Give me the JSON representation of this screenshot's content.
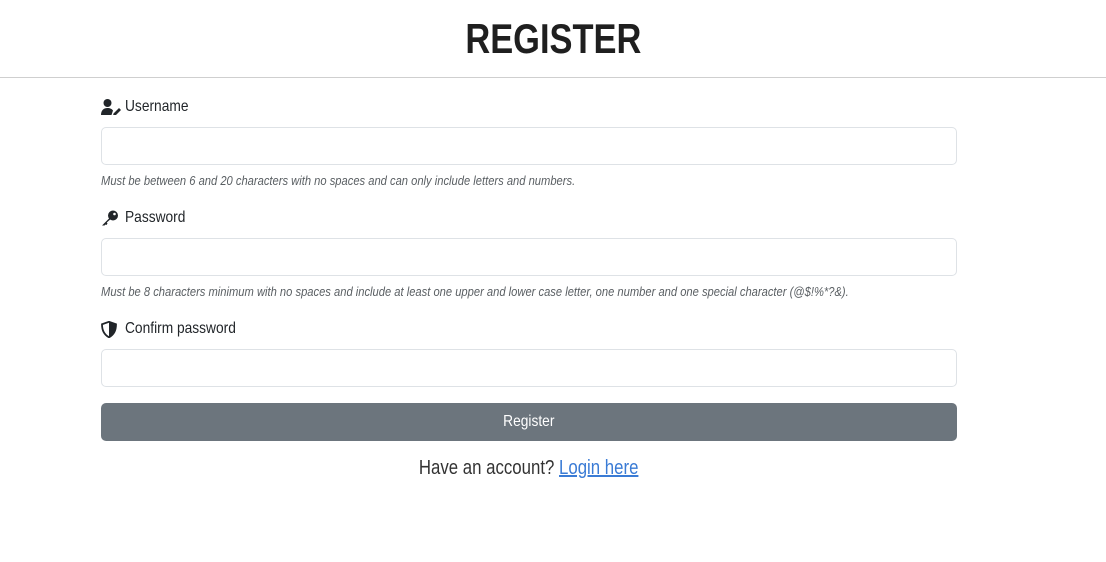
{
  "header": {
    "title": "REGISTER"
  },
  "form": {
    "username": {
      "label": "Username",
      "icon": "user-pen-icon",
      "value": "",
      "help": "Must be between 6 and 20 characters with no spaces and can only include letters and numbers."
    },
    "password": {
      "label": "Password",
      "icon": "key-icon",
      "value": "",
      "help": "Must be 8 characters minimum with no spaces and include at least one upper and lower case letter, one number and one special character (@$!%*?&)."
    },
    "confirm_password": {
      "label": "Confirm password",
      "icon": "shield-half-icon",
      "value": ""
    },
    "submit_label": "Register"
  },
  "footer": {
    "prompt": "Have an account?",
    "link_label": "Login here"
  },
  "colors": {
    "button_bg": "#6c757d",
    "link": "#3a7bd5",
    "divider": "#cfcfcf"
  }
}
